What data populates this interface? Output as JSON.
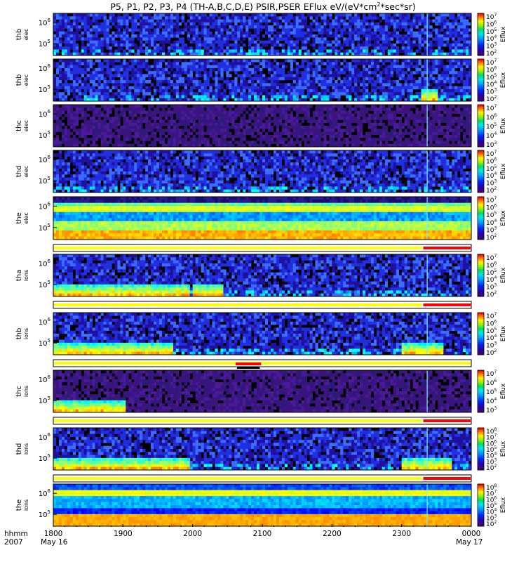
{
  "chart_data": {
    "type": "heatmap",
    "title": "P5, P1, P2, P3, P4 (TH-A,B,C,D,E) PSIR,PSER EFlux eV/(eV*cm²*sec*sr)",
    "xlim": [
      "1800",
      "0000"
    ],
    "x_ticks": [
      "1800",
      "1900",
      "2000",
      "2100",
      "2200",
      "2300",
      "0000"
    ],
    "x_axis_label": [
      "hhmm",
      "2007"
    ],
    "x_start_date": "May 16",
    "x_end_date": "May 17",
    "colorbar_label": "Eflux",
    "y_scale": "log",
    "panels": [
      {
        "name": "thb elec",
        "probe": "thb",
        "species": "elec",
        "yticks": [
          "10⁵",
          "10⁶"
        ],
        "cbar_ticks": [
          "10²",
          "10³",
          "10⁴",
          "10⁵",
          "10⁶",
          "10⁷"
        ],
        "style": "blue",
        "activity": []
      },
      {
        "name": "thb elec",
        "probe": "thb",
        "species": "elec",
        "yticks": [
          "10⁵",
          "10⁶"
        ],
        "cbar_ticks": [
          "10²",
          "10³",
          "10⁴",
          "10⁵",
          "10⁶",
          "10⁷"
        ],
        "style": "blue",
        "activity": [
          {
            "from": 2315,
            "to": 2330
          }
        ]
      },
      {
        "name": "thc elec",
        "probe": "thc",
        "species": "elec",
        "yticks": [
          "10⁵",
          "10⁶"
        ],
        "cbar_ticks": [
          "10³",
          "10⁴",
          "10⁵",
          "10⁶",
          "10⁷"
        ],
        "style": "purple",
        "activity": []
      },
      {
        "name": "thd elec",
        "probe": "thd",
        "species": "elec",
        "yticks": [
          "10⁵",
          "10⁶"
        ],
        "cbar_ticks": [
          "10²",
          "10³",
          "10⁴",
          "10⁵",
          "10⁶",
          "10⁷"
        ],
        "style": "blue",
        "activity": []
      },
      {
        "name": "the elec",
        "probe": "the",
        "species": "elec",
        "yticks": [
          "10⁵",
          "10⁶"
        ],
        "cbar_ticks": [
          "10²",
          "10³",
          "10⁴",
          "10⁵",
          "10⁶",
          "10⁷"
        ],
        "style": "banded",
        "activity": []
      },
      {
        "name": "tha ions",
        "probe": "tha",
        "species": "ions",
        "yticks": [
          "10⁵",
          "10⁶"
        ],
        "cbar_ticks": [
          "10²",
          "10³",
          "10⁴",
          "10⁵",
          "10⁶",
          "10⁷"
        ],
        "style": "blue",
        "activity": [
          {
            "from": 1800,
            "to": 1955
          },
          {
            "from": 2000,
            "to": 2025
          }
        ]
      },
      {
        "name": "thb ions",
        "probe": "thb",
        "species": "ions",
        "yticks": [
          "10⁵",
          "10⁶"
        ],
        "cbar_ticks": [
          "10²",
          "10³",
          "10⁴",
          "10⁵",
          "10⁶",
          "10⁷"
        ],
        "style": "blue",
        "activity": [
          {
            "from": 1800,
            "to": 1940
          },
          {
            "from": 2300,
            "to": 2335
          }
        ]
      },
      {
        "name": "thc ions",
        "probe": "thc",
        "species": "ions",
        "yticks": [
          "10⁵",
          "10⁶"
        ],
        "cbar_ticks": [
          "10³",
          "10⁴",
          "10⁵",
          "10⁶",
          "10⁷"
        ],
        "style": "purple",
        "activity": [
          {
            "from": 1800,
            "to": 1900
          }
        ]
      },
      {
        "name": "thd ions",
        "probe": "thd",
        "species": "ions",
        "yticks": [
          "10⁵",
          "10⁶"
        ],
        "cbar_ticks": [
          "10²",
          "10³",
          "10⁴",
          "10⁵",
          "10⁶",
          "10⁷",
          "10⁸"
        ],
        "style": "blue",
        "activity": [
          {
            "from": 1800,
            "to": 1955
          },
          {
            "from": 2300,
            "to": 2340
          }
        ]
      },
      {
        "name": "the ions",
        "probe": "the",
        "species": "ions",
        "yticks": [
          "10⁵",
          "10⁶"
        ],
        "cbar_ticks": [
          "10²",
          "10³",
          "10⁴",
          "10⁵",
          "10⁶",
          "10⁷",
          "10⁸"
        ],
        "style": "ionband",
        "activity": []
      }
    ],
    "mode_bars": [
      {
        "after_panel": 5,
        "segments": [
          {
            "from": 1800,
            "to": 2318,
            "color": "#ffff00"
          },
          {
            "from": 2318,
            "to": 2400,
            "color": "#ff0000"
          }
        ]
      },
      {
        "after_panel": 6,
        "segments": [
          {
            "from": 1800,
            "to": 2318,
            "color": "#ffff00"
          },
          {
            "from": 2318,
            "to": 2400,
            "color": "#ff0000"
          }
        ]
      },
      {
        "after_panel": 7,
        "segments": [
          {
            "from": 1800,
            "to": 2400,
            "color": "#ffff00"
          }
        ],
        "marks": [
          {
            "from": 2037,
            "to": 2059,
            "color": "#ff0000"
          }
        ]
      },
      {
        "after_panel": 8,
        "segments": [
          {
            "from": 1800,
            "to": 2318,
            "color": "#ffff00"
          },
          {
            "from": 2318,
            "to": 2400,
            "color": "#ff0000"
          }
        ]
      },
      {
        "after_panel": 9,
        "segments": [
          {
            "from": 1800,
            "to": 2318,
            "color": "#ffff00"
          },
          {
            "from": 2318,
            "to": 2400,
            "color": "#ff0000"
          }
        ]
      }
    ],
    "event_line_time": 2322
  }
}
